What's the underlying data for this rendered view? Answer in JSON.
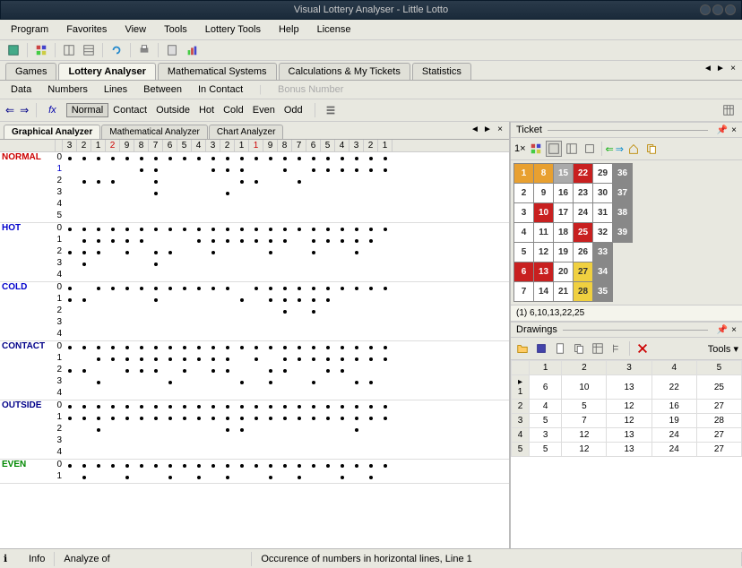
{
  "window": {
    "title": "Visual Lottery Analyser - Little Lotto"
  },
  "menu": {
    "items": [
      "Program",
      "Favorites",
      "View",
      "Tools",
      "Lottery Tools",
      "Help",
      "License"
    ]
  },
  "main_tabs": {
    "items": [
      "Games",
      "Lottery Analyser",
      "Mathematical Systems",
      "Calculations & My Tickets",
      "Statistics"
    ],
    "active": 1
  },
  "subtabs": {
    "items": [
      "Data",
      "Numbers",
      "Lines",
      "Between",
      "In Contact"
    ],
    "disabled": [
      "Bonus Number"
    ]
  },
  "filters": {
    "fx": "fx",
    "items": [
      "Normal",
      "Contact",
      "Outside",
      "Hot",
      "Cold",
      "Even",
      "Odd"
    ],
    "active": 0
  },
  "analyser_tabs": {
    "items": [
      "Graphical Analyzer",
      "Mathematical Analyzer",
      "Chart Analyzer"
    ],
    "active": 0
  },
  "chart_data": {
    "type": "dot-matrix",
    "columns": [
      "3",
      "2",
      "1",
      "2",
      "9",
      "8",
      "7",
      "6",
      "5",
      "4",
      "3",
      "2",
      "1",
      "1",
      "9",
      "8",
      "7",
      "6",
      "5",
      "4",
      "3",
      "2",
      "1"
    ],
    "red_cols": [
      3,
      13
    ],
    "sections": [
      {
        "name": "NORMAL",
        "class": "normal",
        "rows": 6,
        "blueIdx": 1,
        "dots": {
          "0": [
            0,
            1,
            2,
            3,
            4,
            5,
            6,
            7,
            8,
            9,
            10,
            11,
            12,
            13,
            14,
            15,
            16,
            17,
            18,
            19,
            20,
            21,
            22
          ],
          "1": [
            5,
            6,
            10,
            11,
            12,
            15,
            17,
            18,
            19,
            20,
            21,
            22
          ],
          "2": [
            1,
            2,
            3,
            6,
            12,
            13,
            16
          ],
          "3": [
            6,
            11
          ],
          "4": [],
          "5": []
        }
      },
      {
        "name": "HOT",
        "class": "hot",
        "rows": 5,
        "dots": {
          "0": [
            0,
            1,
            2,
            3,
            4,
            5,
            6,
            7,
            8,
            9,
            10,
            11,
            12,
            13,
            14,
            15,
            16,
            17,
            18,
            19,
            20,
            21,
            22
          ],
          "1": [
            1,
            2,
            3,
            4,
            5,
            9,
            10,
            11,
            12,
            13,
            14,
            15,
            17,
            18,
            19,
            20,
            21
          ],
          "2": [
            0,
            1,
            2,
            4,
            6,
            7,
            10,
            14,
            17,
            20
          ],
          "3": [
            1,
            6
          ],
          "4": []
        }
      },
      {
        "name": "COLD",
        "class": "cold",
        "rows": 5,
        "dots": {
          "0": [
            0,
            2,
            3,
            4,
            5,
            6,
            7,
            8,
            9,
            10,
            11,
            13,
            14,
            15,
            16,
            17,
            18,
            19,
            20,
            21,
            22
          ],
          "1": [
            0,
            1,
            6,
            12,
            14,
            15,
            16,
            17,
            18
          ],
          "2": [
            15,
            17
          ],
          "3": [],
          "4": []
        }
      },
      {
        "name": "CONTACT",
        "class": "contact",
        "rows": 5,
        "dots": {
          "0": [
            0,
            1,
            2,
            3,
            4,
            5,
            6,
            7,
            8,
            9,
            10,
            11,
            12,
            13,
            14,
            15,
            16,
            17,
            18,
            19,
            20,
            21,
            22
          ],
          "1": [
            2,
            3,
            4,
            5,
            6,
            7,
            8,
            9,
            10,
            11,
            13,
            15,
            16,
            17,
            18,
            19,
            20,
            21,
            22
          ],
          "2": [
            0,
            1,
            4,
            5,
            6,
            8,
            10,
            11,
            14,
            15,
            18,
            19
          ],
          "3": [
            2,
            7,
            12,
            14,
            17,
            20,
            21
          ],
          "4": []
        }
      },
      {
        "name": "OUTSIDE",
        "class": "outside",
        "rows": 5,
        "dots": {
          "0": [
            0,
            1,
            2,
            3,
            4,
            5,
            6,
            7,
            8,
            9,
            10,
            11,
            12,
            13,
            14,
            15,
            16,
            17,
            18,
            19,
            20,
            21,
            22
          ],
          "1": [
            0,
            1,
            2,
            3,
            4,
            5,
            6,
            7,
            8,
            9,
            10,
            11,
            12,
            13,
            14,
            15,
            16,
            17,
            18,
            19,
            20,
            21,
            22
          ],
          "2": [
            2,
            11,
            12,
            20
          ],
          "3": [],
          "4": []
        }
      },
      {
        "name": "EVEN",
        "class": "even",
        "rows": 2,
        "dots": {
          "0": [
            0,
            1,
            2,
            3,
            4,
            5,
            6,
            7,
            8,
            9,
            10,
            11,
            12,
            13,
            14,
            15,
            16,
            17,
            18,
            19,
            20,
            21,
            22
          ],
          "1": [
            1,
            4,
            7,
            9,
            11,
            14,
            16,
            19,
            21
          ]
        }
      }
    ]
  },
  "ticket": {
    "title": "Ticket",
    "prefix": "1×",
    "grid": [
      [
        {
          "n": "1",
          "c": "orange"
        },
        {
          "n": "8",
          "c": "orange"
        },
        {
          "n": "15",
          "c": "gray"
        },
        {
          "n": "22",
          "c": "red"
        },
        {
          "n": "29",
          "c": "white"
        },
        {
          "n": "36",
          "c": "dkgray"
        }
      ],
      [
        {
          "n": "2",
          "c": "white"
        },
        {
          "n": "9",
          "c": "white"
        },
        {
          "n": "16",
          "c": "white"
        },
        {
          "n": "23",
          "c": "white"
        },
        {
          "n": "30",
          "c": "white"
        },
        {
          "n": "37",
          "c": "dkgray"
        }
      ],
      [
        {
          "n": "3",
          "c": "white"
        },
        {
          "n": "10",
          "c": "red"
        },
        {
          "n": "17",
          "c": "white"
        },
        {
          "n": "24",
          "c": "white"
        },
        {
          "n": "31",
          "c": "white"
        },
        {
          "n": "38",
          "c": "dkgray"
        }
      ],
      [
        {
          "n": "4",
          "c": "white"
        },
        {
          "n": "11",
          "c": "white"
        },
        {
          "n": "18",
          "c": "white"
        },
        {
          "n": "25",
          "c": "red"
        },
        {
          "n": "32",
          "c": "white"
        },
        {
          "n": "39",
          "c": "dkgray"
        }
      ],
      [
        {
          "n": "5",
          "c": "white"
        },
        {
          "n": "12",
          "c": "white"
        },
        {
          "n": "19",
          "c": "white"
        },
        {
          "n": "26",
          "c": "white"
        },
        {
          "n": "33",
          "c": "dkgray"
        },
        {
          "n": "",
          "c": ""
        }
      ],
      [
        {
          "n": "6",
          "c": "red"
        },
        {
          "n": "13",
          "c": "red"
        },
        {
          "n": "20",
          "c": "white"
        },
        {
          "n": "27",
          "c": "yellow"
        },
        {
          "n": "34",
          "c": "dkgray"
        },
        {
          "n": "",
          "c": ""
        }
      ],
      [
        {
          "n": "7",
          "c": "white"
        },
        {
          "n": "14",
          "c": "white"
        },
        {
          "n": "21",
          "c": "white"
        },
        {
          "n": "28",
          "c": "yellow"
        },
        {
          "n": "35",
          "c": "dkgray"
        },
        {
          "n": "",
          "c": ""
        }
      ]
    ],
    "status": "(1) 6,10,13,22,25"
  },
  "drawings": {
    "title": "Drawings",
    "tools_label": "Tools",
    "headers": [
      "",
      "1",
      "2",
      "3",
      "4",
      "5"
    ],
    "rows": [
      [
        "1",
        "6",
        "10",
        "13",
        "22",
        "25"
      ],
      [
        "2",
        "4",
        "5",
        "12",
        "16",
        "27"
      ],
      [
        "3",
        "5",
        "7",
        "12",
        "19",
        "28"
      ],
      [
        "4",
        "3",
        "12",
        "13",
        "24",
        "27"
      ],
      [
        "5",
        "5",
        "12",
        "13",
        "24",
        "27"
      ]
    ]
  },
  "statusbar": {
    "info": "Info",
    "analyze": "Analyze of",
    "occurrence": "Occurence of numbers in horizontal lines, Line 1"
  }
}
